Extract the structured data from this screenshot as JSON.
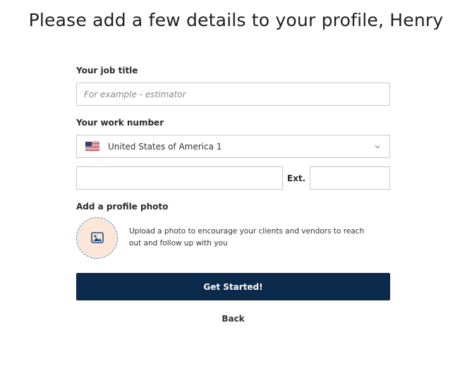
{
  "header": {
    "title": "Please add a few details to your profile, Henry"
  },
  "job_title": {
    "label": "Your job title",
    "value": "",
    "placeholder": "For example - estimator"
  },
  "work_number": {
    "label": "Your work number",
    "country": {
      "selected": "United States of America 1",
      "flag_icon": "us-flag-icon"
    },
    "phone_value": "",
    "ext_label": "Ext.",
    "ext_value": ""
  },
  "profile_photo": {
    "label": "Add a profile photo",
    "description": "Upload a photo to encourage your clients and vendors to reach out and follow up with you",
    "icon": "image-icon"
  },
  "actions": {
    "submit_label": "Get Started!",
    "back_label": "Back"
  },
  "colors": {
    "primary": "#0c2a4b",
    "photo_bg": "#fbe6d8",
    "photo_border": "#4a90c8"
  }
}
